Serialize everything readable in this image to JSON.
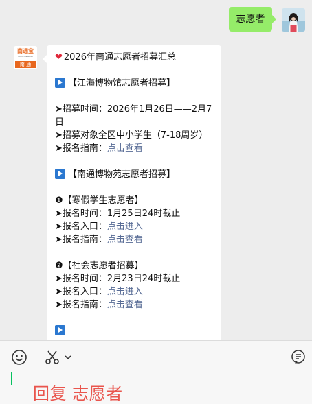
{
  "outgoing": {
    "text": "志愿者"
  },
  "incoming": {
    "avatar_text_top": "南通宝",
    "avatar_text_sub": "NANTONGBAO",
    "avatar_text_bottom": "南 通",
    "lines": [
      {
        "type": "title",
        "icon": "heart",
        "text": "2026年南通志愿者招募汇总"
      },
      {
        "type": "gap"
      },
      {
        "type": "section",
        "icon": "play-square",
        "text": "【江海博物馆志愿者招募】"
      },
      {
        "type": "gap"
      },
      {
        "type": "text",
        "text": "➤招募时间：2026年1月26日——2月7日"
      },
      {
        "type": "text",
        "text": "➤招募对象全区中小学生（7-18周岁）"
      },
      {
        "type": "link",
        "prefix": "➤报名指南：",
        "link": "点击查看"
      },
      {
        "type": "gap"
      },
      {
        "type": "section",
        "icon": "play-square",
        "text": "【南通博物苑志愿者招募】"
      },
      {
        "type": "gap"
      },
      {
        "type": "text",
        "text": "❶【寒假学生志愿者】"
      },
      {
        "type": "text",
        "text": "➤报名时间：1月25日24时截止"
      },
      {
        "type": "link",
        "prefix": "➤报名入口：",
        "link": "点击进入"
      },
      {
        "type": "link",
        "prefix": "➤报名指南：",
        "link": "点击查看"
      },
      {
        "type": "gap"
      },
      {
        "type": "text",
        "text": "❷【社会志愿者招募】"
      },
      {
        "type": "text",
        "text": "➤报名时间：2月23日24时截止"
      },
      {
        "type": "link",
        "prefix": "➤报名入口：",
        "link": "点击进入"
      },
      {
        "type": "link",
        "prefix": "➤报名指南：",
        "link": "点击查看"
      },
      {
        "type": "gap"
      },
      {
        "type": "section",
        "icon": "play-square",
        "text": ""
      }
    ]
  },
  "input": {
    "text": "回复 志愿者"
  },
  "colors": {
    "outgoing_bubble": "#95ec69",
    "link": "#576b95",
    "section_icon": "#2b78d0",
    "heart": "#e0283a",
    "reply_text": "#e9554d",
    "cursor": "#07c160"
  },
  "icons": {
    "emoji": "smiley-icon",
    "scissors": "scissors-icon",
    "dropdown": "chevron-down-icon",
    "voice": "voice-bubble-icon"
  }
}
